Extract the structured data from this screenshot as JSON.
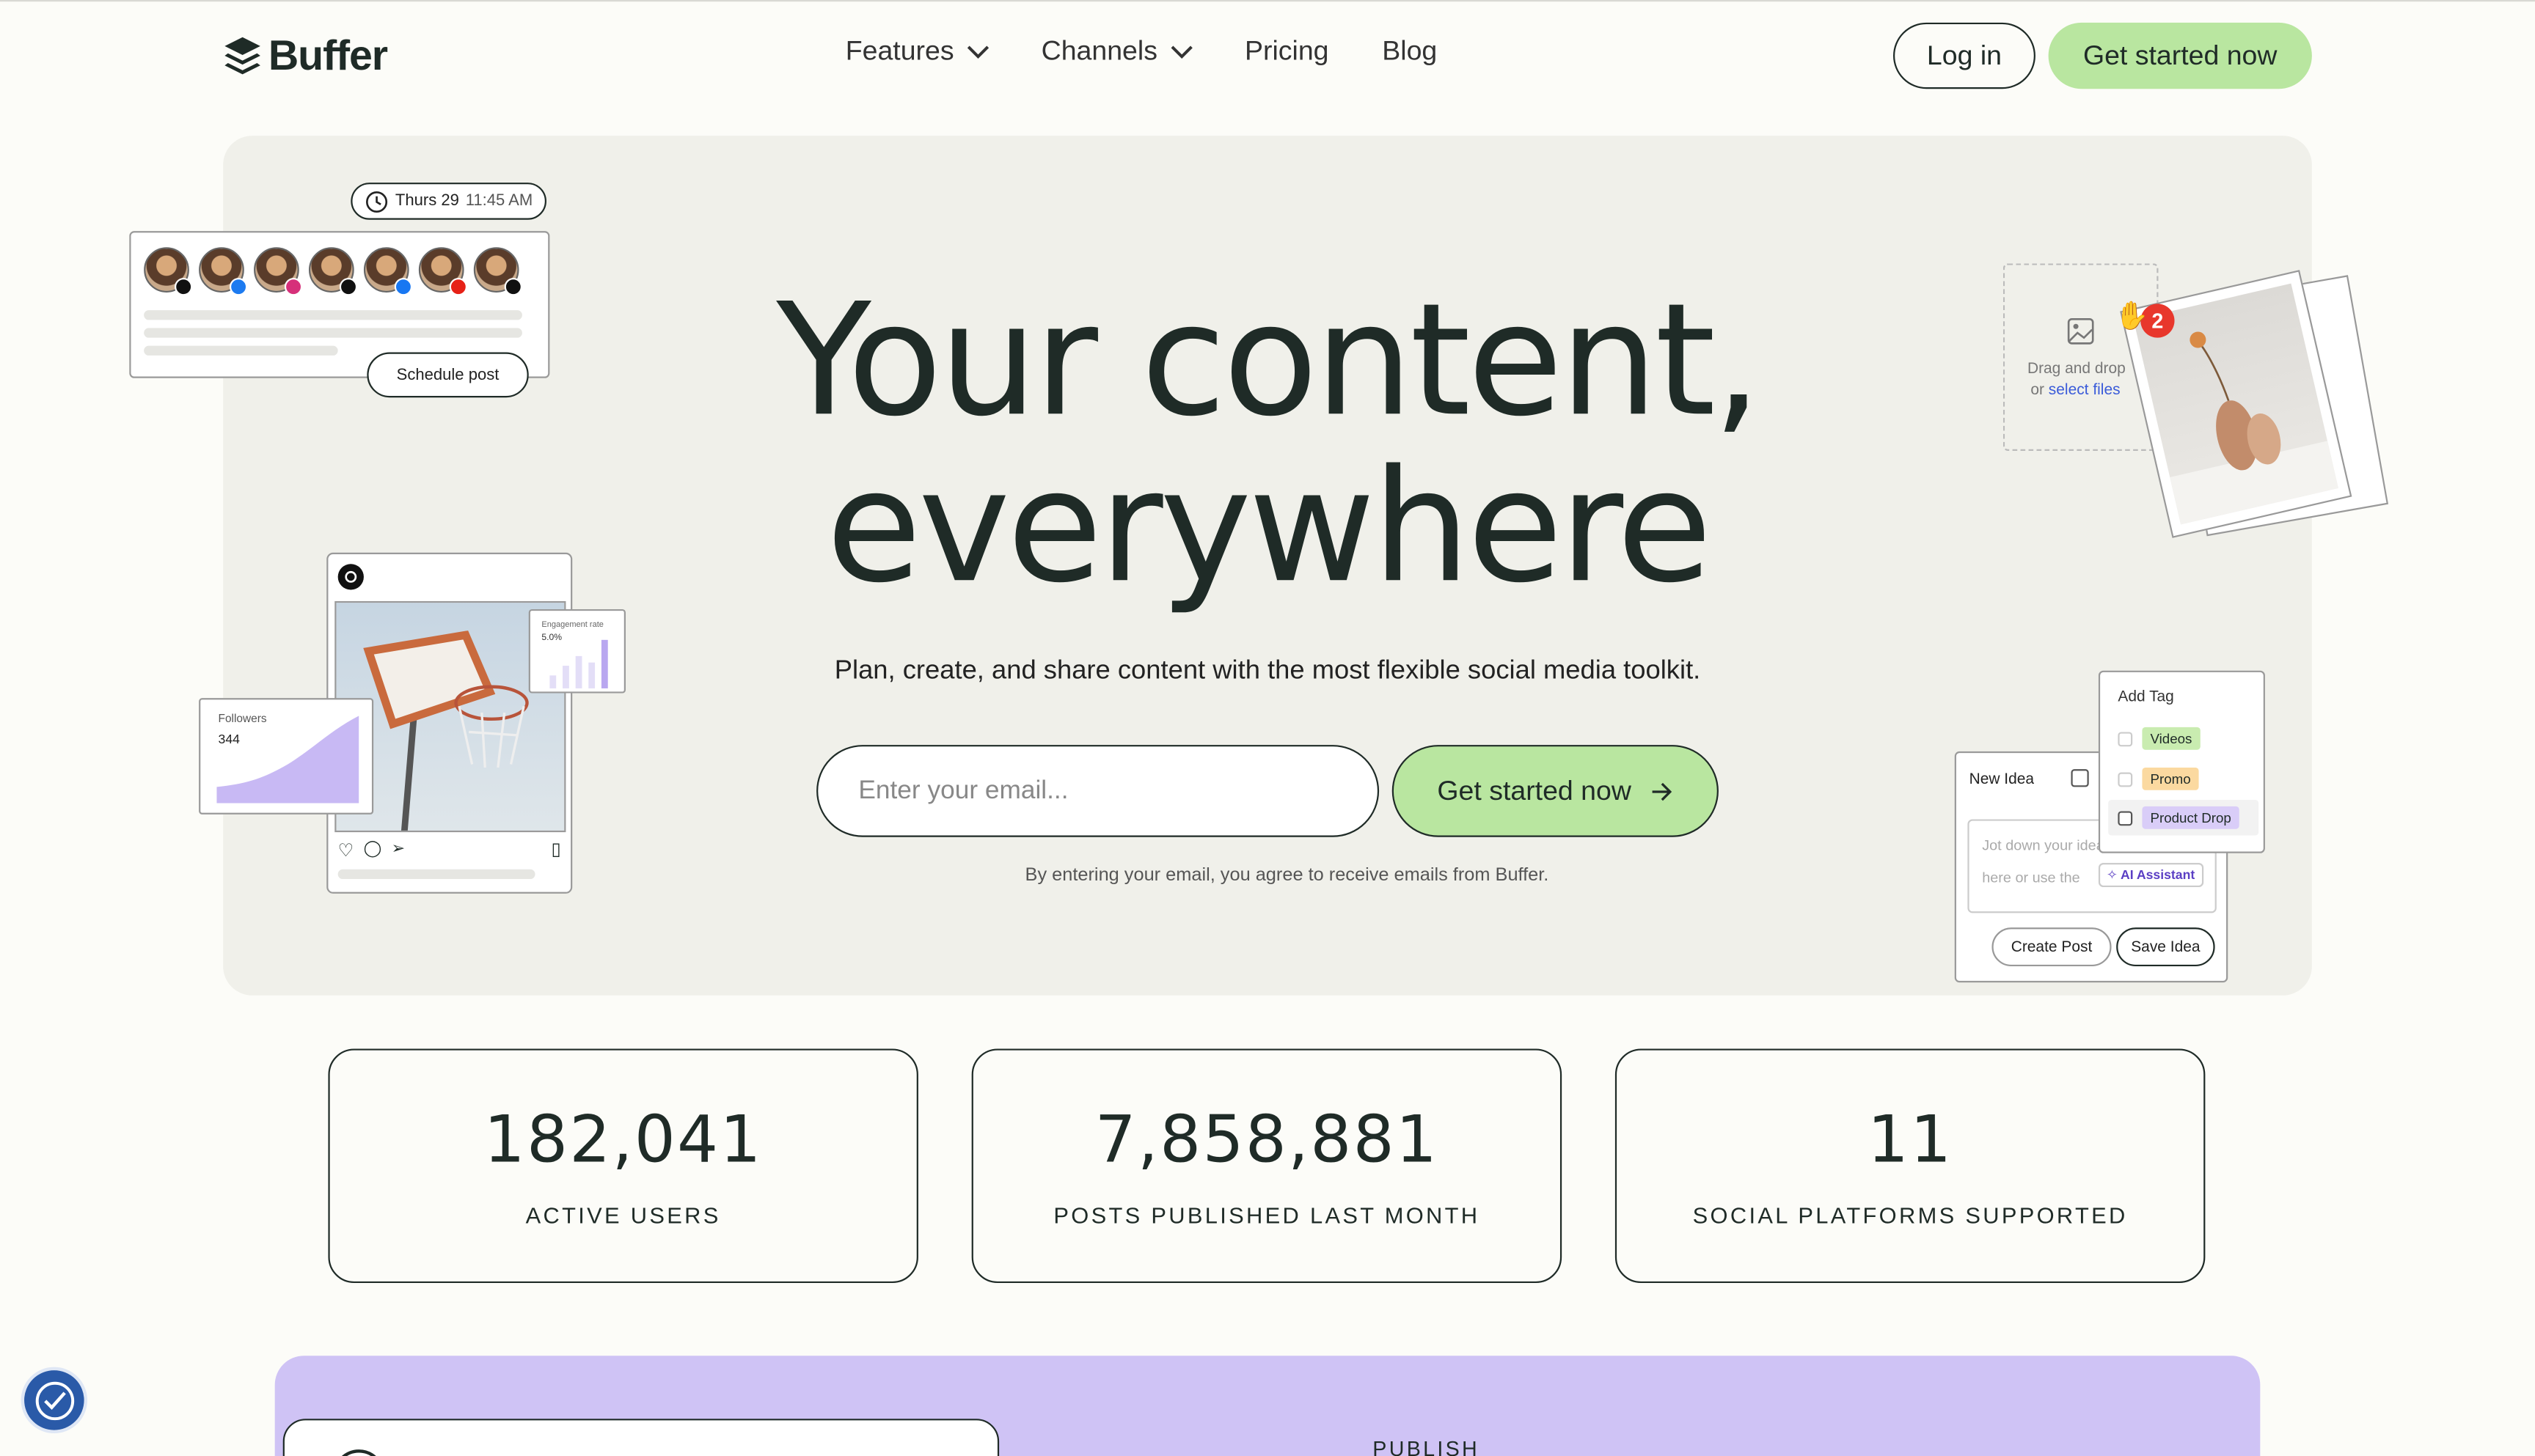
{
  "nav": {
    "logo_text": "Buffer",
    "items": [
      "Features",
      "Channels",
      "Pricing",
      "Blog"
    ],
    "login": "Log in",
    "cta": "Get started now"
  },
  "hero": {
    "title_line1": "Your content,",
    "title_line2": "everywhere",
    "subtitle": "Plan, create, and share content with the most flexible social media toolkit.",
    "email_placeholder": "Enter your email...",
    "cta": "Get started now",
    "disclaimer": "By entering your email, you agree to receive emails from Buffer."
  },
  "schedule_card": {
    "day": "Thurs 29",
    "time": "11:45 AM",
    "button": "Schedule post"
  },
  "post_card": {
    "engagement_label": "Engagement rate",
    "engagement_value": "5.0%",
    "followers_label": "Followers",
    "followers_value": "344"
  },
  "upload_card": {
    "text_line1": "Drag and drop",
    "text_or": "or",
    "text_link": "select files",
    "badge": "2"
  },
  "idea_card": {
    "title": "New Idea",
    "placeholder_line1": "Jot down your ideas",
    "placeholder_line2": "here or use the",
    "ai": "AI Assistant",
    "create": "Create Post",
    "save": "Save Idea"
  },
  "tag_card": {
    "title": "Add Tag",
    "tags": [
      "Videos",
      "Promo",
      "Product Drop"
    ]
  },
  "stats": [
    {
      "value": "182,041",
      "label": "ACTIVE USERS"
    },
    {
      "value": "7,858,881",
      "label": "POSTS PUBLISHED LAST MONTH"
    },
    {
      "value": "11",
      "label": "SOCIAL PLATFORMS SUPPORTED"
    }
  ],
  "section": {
    "label": "PUBLISH"
  },
  "colors": {
    "accent_green": "#b9e6a0",
    "accent_purple": "#cfc3f5",
    "dark": "#1f2b27"
  }
}
